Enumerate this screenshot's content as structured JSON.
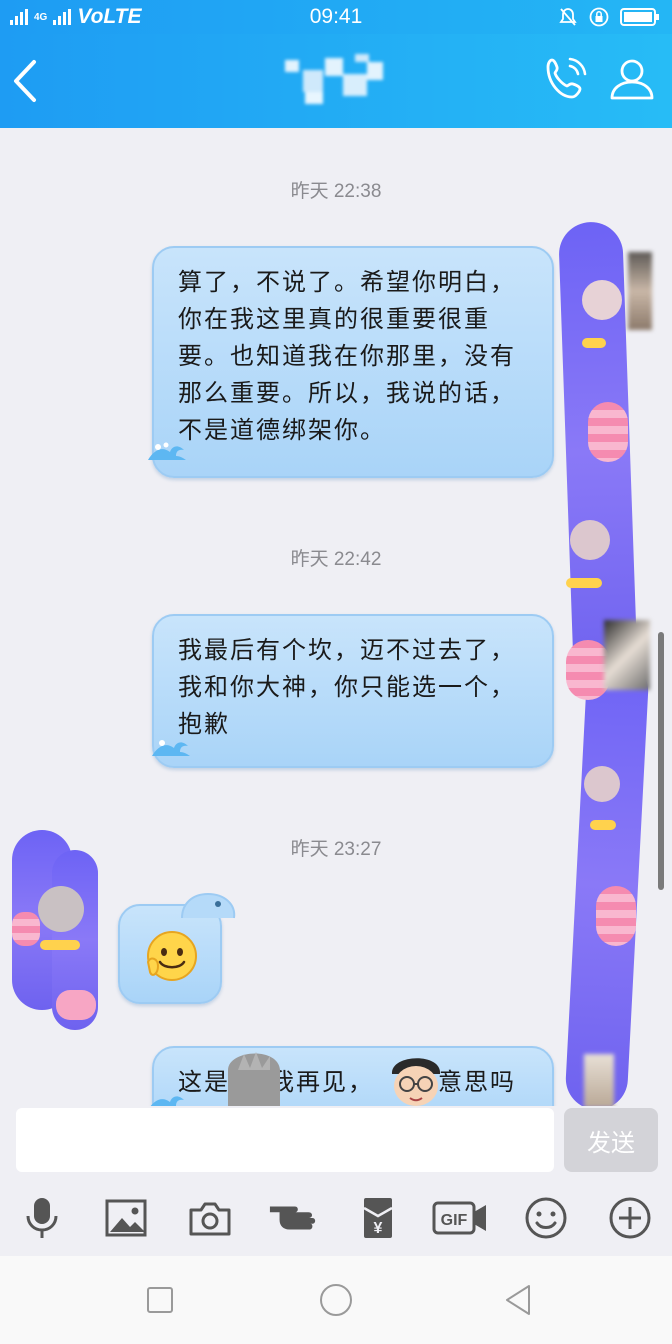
{
  "status_bar": {
    "network": "VoLTE",
    "network_small": "4G",
    "time": "09:41"
  },
  "nav": {
    "back_icon": "chevron-left-icon",
    "call_icon": "phone-icon",
    "profile_icon": "user-icon"
  },
  "messages": [
    {
      "timestamp": "昨天 22:38",
      "text": "算了，不说了。希望你明白，你在我这里真的很重要很重要。也知道我在你那里，没有那么重要。所以，我说的话，不是道德绑架你。"
    },
    {
      "timestamp": "昨天 22:42",
      "text": "我最后有个坎，迈不过去了，我和你大神，你只能选一个，抱歉"
    },
    {
      "timestamp": "昨天 23:27",
      "sticker": "smiling-emoji-icon"
    },
    {
      "text_part1": "这是",
      "text_part2": "我再见，",
      "text_part3": "意思吗"
    }
  ],
  "input": {
    "placeholder": "",
    "send_label": "发送"
  },
  "toolbar": {
    "items": [
      "microphone-icon",
      "image-icon",
      "camera-icon",
      "poke-icon",
      "red-packet-icon",
      "gif-icon",
      "emoji-icon",
      "plus-icon"
    ],
    "gif_label": "GIF",
    "red_packet_label": "¥"
  },
  "colors": {
    "nav_bg": "#1e9cf3",
    "bubble": "#b5daf9",
    "send_disabled": "#d3d3d8",
    "chat_bg": "#efeff4"
  }
}
